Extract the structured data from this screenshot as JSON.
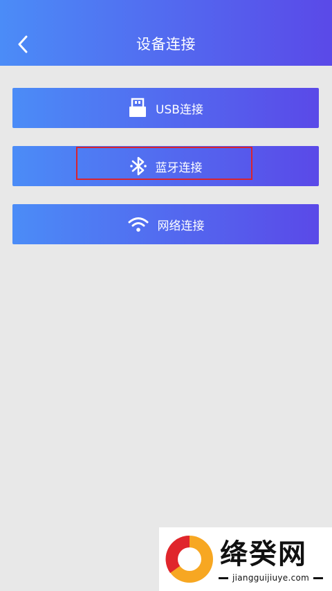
{
  "header": {
    "title": "设备连接",
    "back_icon": "chevron-left-icon"
  },
  "connections": [
    {
      "label": "USB连接",
      "icon": "usb-icon"
    },
    {
      "label": "蓝牙连接",
      "icon": "bluetooth-icon"
    },
    {
      "label": "网络连接",
      "icon": "wifi-icon"
    }
  ],
  "highlight_color": "#d9232d",
  "colors": {
    "gradient_start": "#4b8cf7",
    "gradient_end": "#5a49e8",
    "background": "#e8e8e8"
  },
  "watermark": {
    "name": "绛癸网",
    "url": "jiangguijiuye.com"
  }
}
